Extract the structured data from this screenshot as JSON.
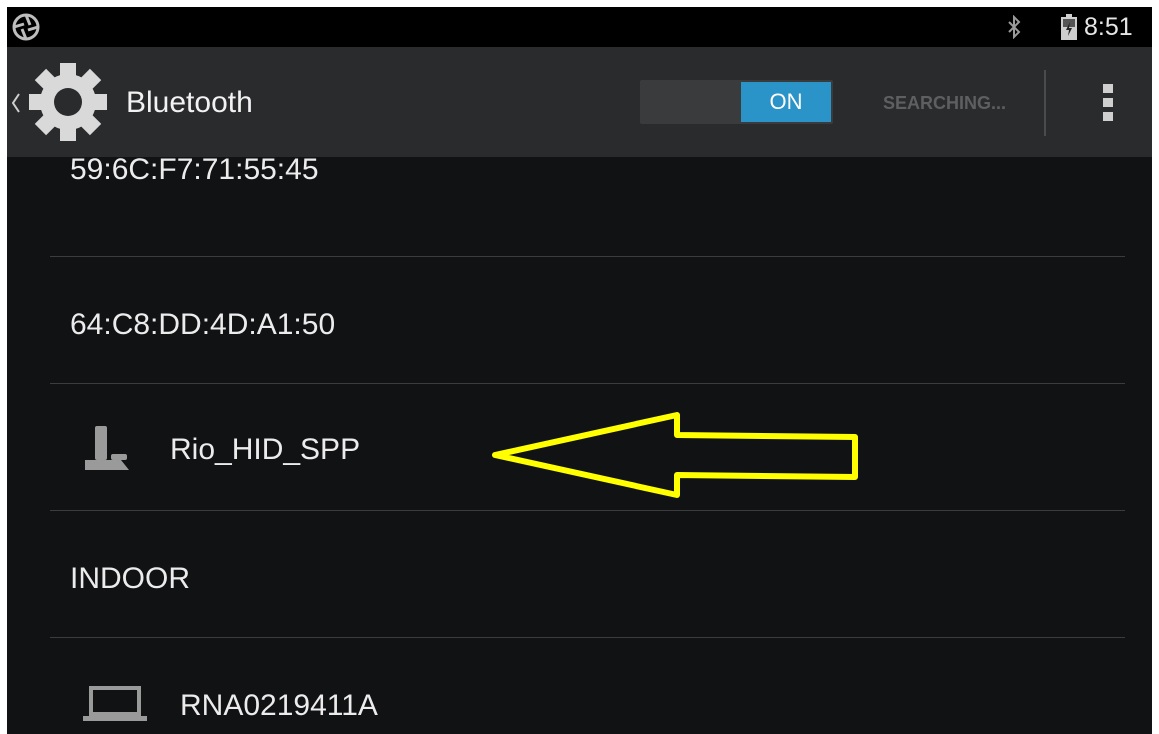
{
  "status_bar": {
    "time": "8:51",
    "icons": [
      "camera-shutter-icon",
      "bluetooth-icon",
      "battery-icon"
    ]
  },
  "action_bar": {
    "title": "Bluetooth",
    "toggle_label": "ON",
    "status_text": "SEARCHING...",
    "icons": [
      "back-chevron-icon",
      "gear-icon",
      "overflow-menu-icon"
    ]
  },
  "devices": [
    {
      "name": "59:6C:F7:71:55:45",
      "icon": ""
    },
    {
      "name": "64:C8:DD:4D:A1:50",
      "icon": ""
    },
    {
      "name": "Rio_HID_SPP",
      "icon": "joystick-icon"
    },
    {
      "name": "INDOOR",
      "icon": ""
    },
    {
      "name": "RNA0219411A",
      "icon": "laptop-icon"
    }
  ],
  "colors": {
    "background": "#111214",
    "action_bar": "#2a2b2d",
    "toggle_on": "#2a93c7",
    "annotation_arrow": "#ffff00"
  }
}
